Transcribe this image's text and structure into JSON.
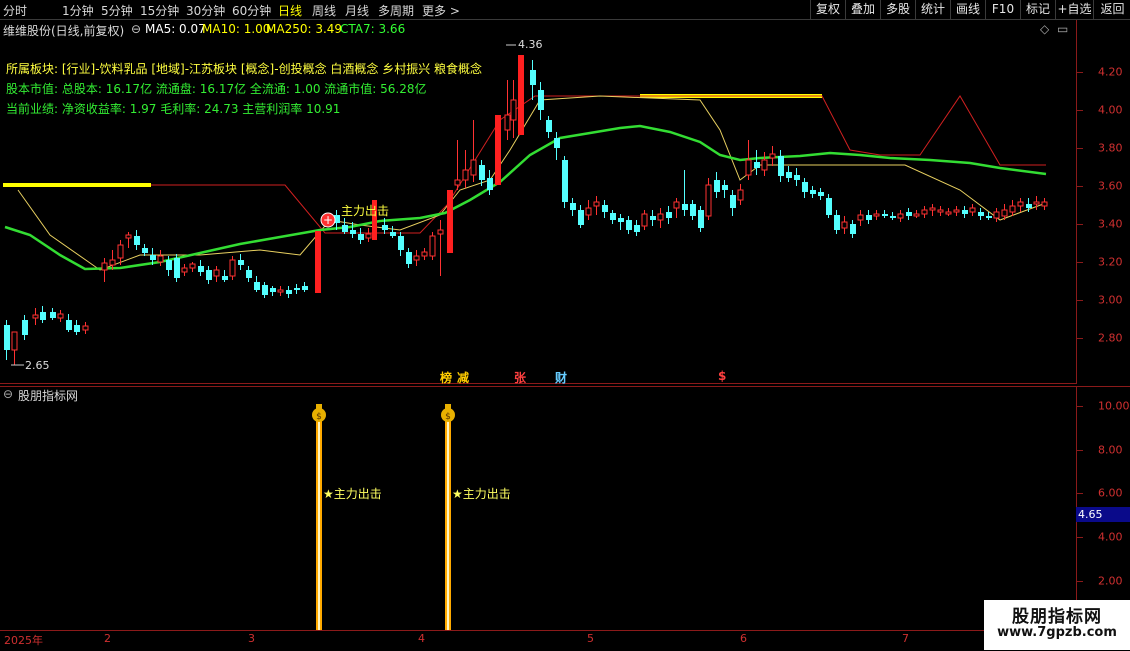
{
  "toolbar": {
    "periods": [
      "分时",
      "1分钟",
      "5分钟",
      "15分钟",
      "30分钟",
      "60分钟",
      "日线",
      "周线",
      "月线",
      "多周期",
      "更多 >"
    ],
    "active_period": "日线",
    "buttons": [
      "复权",
      "叠加",
      "多股",
      "统计",
      "画线",
      "F10",
      "标记",
      "+自选",
      "返回"
    ]
  },
  "price_header": {
    "stock_title": "维维股份(日线,前复权)",
    "ma5": "MA5: 0.07",
    "ma10": "MA10: 1.00",
    "ma250": "MA250: 3.49",
    "cta7": "CTA7: 3.66"
  },
  "info_lines": {
    "sectors": "所属板块: [行业]-饮料乳品 [地域]-江苏板块 [概念]-创投概念 白酒概念 乡村振兴 粮食概念",
    "market_value": "股本市值: 总股本: 16.17亿 流通盘: 16.17亿 全流通: 1.00 流通市值: 56.28亿",
    "performance": "当前业绩: 净资收益率: 1.97 毛利率: 24.73 主营利润率 10.91"
  },
  "price_axis": [
    "4.20",
    "4.00",
    "3.80",
    "3.60",
    "3.40",
    "3.20",
    "3.00",
    "2.80"
  ],
  "annotations": {
    "high_label": "4.36",
    "low_label": "2.65",
    "main_signal": "主力出击",
    "event_tags": [
      "榜",
      "减",
      "张",
      "财",
      "$"
    ]
  },
  "indicator": {
    "title": "股朋指标网",
    "axis": [
      "10.00",
      "8.00",
      "6.00",
      "4.00",
      "2.00"
    ],
    "current_value": "4.65",
    "signal_labels": [
      "★主力出击",
      "★主力出击"
    ],
    "money_icon": "money-bag-icon"
  },
  "date_axis": [
    "2025年",
    "2",
    "3",
    "4",
    "5",
    "6",
    "7"
  ],
  "watermark": {
    "line1": "股朋指标网",
    "line2": "www.7gpzb.com"
  },
  "colors": {
    "up_candle": "#ff3232",
    "down_candle": "#54ffff",
    "ma_green": "#33dd33",
    "ma_yellow": "#ffff66",
    "signal_bar": "#ffaa00",
    "axis_red": "#d03030"
  }
}
